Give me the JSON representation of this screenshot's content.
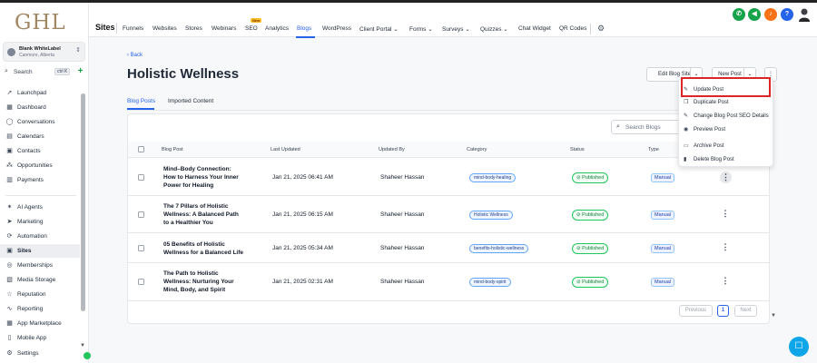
{
  "brand": {
    "logo_text": "GHL"
  },
  "account": {
    "name": "Blank WhiteLabel",
    "location": "Canmore, Alberta"
  },
  "sidebar": {
    "search_label": "Search",
    "search_shortcut": "ctrl K",
    "group1": [
      {
        "label": "Launchpad",
        "icon": "rocket-icon"
      },
      {
        "label": "Dashboard",
        "icon": "dashboard-icon"
      },
      {
        "label": "Conversations",
        "icon": "chat-icon"
      },
      {
        "label": "Calendars",
        "icon": "calendar-icon"
      },
      {
        "label": "Contacts",
        "icon": "contacts-icon"
      },
      {
        "label": "Opportunities",
        "icon": "opportunities-icon"
      },
      {
        "label": "Payments",
        "icon": "payments-icon"
      }
    ],
    "group2": [
      {
        "label": "AI Agents",
        "icon": "ai-icon"
      },
      {
        "label": "Marketing",
        "icon": "marketing-icon"
      },
      {
        "label": "Automation",
        "icon": "automation-icon"
      },
      {
        "label": "Sites",
        "icon": "sites-icon",
        "active": true
      },
      {
        "label": "Memberships",
        "icon": "memberships-icon"
      },
      {
        "label": "Media Storage",
        "icon": "media-icon"
      },
      {
        "label": "Reputation",
        "icon": "star-icon"
      },
      {
        "label": "Reporting",
        "icon": "reporting-icon"
      },
      {
        "label": "App Marketplace",
        "icon": "marketplace-icon"
      },
      {
        "label": "Mobile App",
        "icon": "mobile-icon"
      }
    ],
    "settings_label": "Settings"
  },
  "topnav": {
    "title": "Sites",
    "new_badge": "New",
    "tabs": [
      "Funnels",
      "Websites",
      "Stores",
      "Webinars",
      "SEO",
      "Analytics",
      "Blogs",
      "WordPress",
      "Client Portal",
      "Forms",
      "Surveys",
      "Quizzes",
      "Chat Widget",
      "QR Codes"
    ],
    "active_tab": "Blogs"
  },
  "page": {
    "back_label": "Back",
    "title": "Holistic Wellness",
    "edit_blog_site": "Edit Blog Site",
    "new_post": "New Post"
  },
  "content_tabs": [
    "Blog Posts",
    "Imported Content"
  ],
  "search": {
    "placeholder": "Search Blogs"
  },
  "table": {
    "headers": [
      "Blog Post",
      "Last Updated",
      "Updated By",
      "Category",
      "Status",
      "Type"
    ],
    "rows": [
      {
        "title": "Mind–Body Connection: How to Harness Your Inner Power for Healing",
        "updated": "Jan 21, 2025 06:41 AM",
        "by": "Shaheer Hassan",
        "category": "mind-body-healing",
        "status": "Published",
        "type": "Manual"
      },
      {
        "title": "The 7 Pillars of Holistic Wellness: A Balanced Path to a Healthier You",
        "updated": "Jan 21, 2025 06:15 AM",
        "by": "Shaheer Hassan",
        "category": "Holistic Wellness",
        "status": "Published",
        "type": "Manual"
      },
      {
        "title": "05 Benefits of Holistic Wellness for a Balanced Life",
        "updated": "Jan 21, 2025 05:34 AM",
        "by": "Shaheer Hassan",
        "category": "benefits-holistic-wellness",
        "status": "Published",
        "type": "Manual"
      },
      {
        "title": "The Path to Holistic Wellness: Nurturing Your Mind, Body, and Spirit",
        "updated": "Jan 21, 2025 02:31 AM",
        "by": "Shaheer Hassan",
        "category": "mind-body-spirit",
        "status": "Published",
        "type": "Manual"
      }
    ]
  },
  "pagination": {
    "previous": "Previous",
    "current": "1",
    "next": "Next"
  },
  "dropdown": {
    "items": [
      {
        "label": "Update Post",
        "icon": "pencil-icon"
      },
      {
        "label": "Duplicate Post",
        "icon": "duplicate-icon"
      },
      {
        "label": "Change Blog Post SEO Details",
        "icon": "pencil-icon"
      },
      {
        "label": "Preview Post",
        "icon": "eye-icon"
      },
      {
        "label": "Archive Post",
        "icon": "archive-icon"
      },
      {
        "label": "Delete Blog Post",
        "icon": "trash-icon"
      }
    ]
  },
  "colors": {
    "accent": "#2563eb",
    "brand_gold": "#a08763",
    "published_green": "#22c55e",
    "highlight_red": "#dc2626"
  }
}
